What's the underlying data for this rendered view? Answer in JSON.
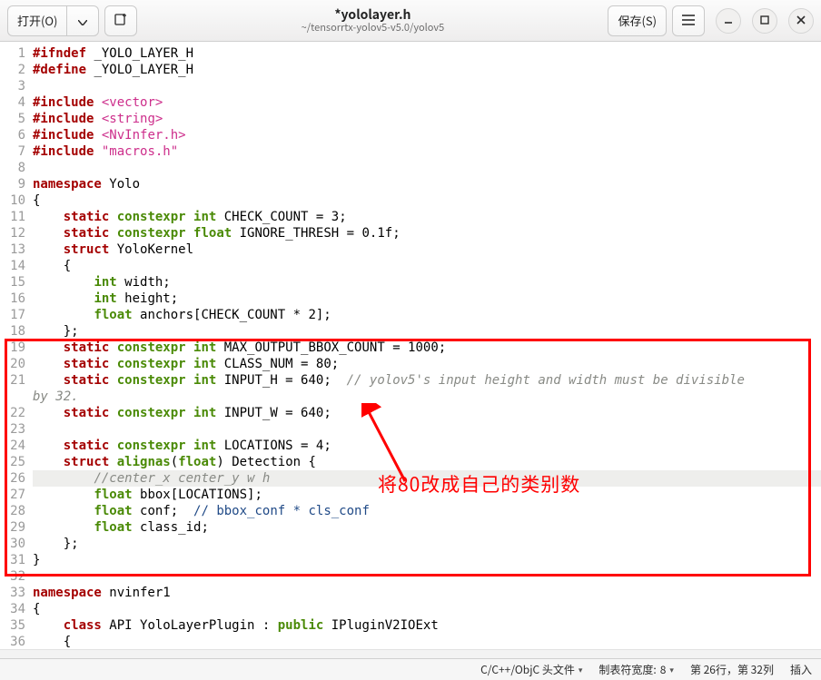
{
  "header": {
    "open_label": "打开(O)",
    "open_dropdown_icon": "chevron-down-icon",
    "new_tab_icon": "new-tab-icon",
    "title": "*yololayer.h",
    "subtitle": "~/tensorrtx-yolov5-v5.0/yolov5",
    "save_label": "保存(S)",
    "menu_icon": "hamburger-icon",
    "min_icon": "minimize-icon",
    "max_icon": "maximize-icon",
    "close_icon": "close-icon"
  },
  "annotation": {
    "text": "将80改成自己的类别数"
  },
  "status": {
    "filetype": "C/C++/ObjC 头文件",
    "tabwidth_label": "制表符宽度: ",
    "tabwidth_value": "8",
    "cursor": "第 26行，第 32列",
    "insert_mode": "插入"
  },
  "code": [
    {
      "n": 1,
      "segs": [
        {
          "c": "kw-pp",
          "t": "#ifndef"
        },
        {
          "c": "plain",
          "t": " _YOLO_LAYER_H"
        }
      ]
    },
    {
      "n": 2,
      "segs": [
        {
          "c": "kw-pp",
          "t": "#define"
        },
        {
          "c": "plain",
          "t": " _YOLO_LAYER_H"
        }
      ]
    },
    {
      "n": 3,
      "segs": [
        {
          "c": "plain",
          "t": ""
        }
      ]
    },
    {
      "n": 4,
      "segs": [
        {
          "c": "kw-pp",
          "t": "#include"
        },
        {
          "c": "plain",
          "t": " "
        },
        {
          "c": "str",
          "t": "<vector>"
        }
      ]
    },
    {
      "n": 5,
      "segs": [
        {
          "c": "kw-pp",
          "t": "#include"
        },
        {
          "c": "plain",
          "t": " "
        },
        {
          "c": "str",
          "t": "<string>"
        }
      ]
    },
    {
      "n": 6,
      "segs": [
        {
          "c": "kw-pp",
          "t": "#include"
        },
        {
          "c": "plain",
          "t": " "
        },
        {
          "c": "str",
          "t": "<NvInfer.h>"
        }
      ]
    },
    {
      "n": 7,
      "segs": [
        {
          "c": "kw-pp",
          "t": "#include"
        },
        {
          "c": "plain",
          "t": " "
        },
        {
          "c": "str",
          "t": "\"macros.h\""
        }
      ]
    },
    {
      "n": 8,
      "segs": [
        {
          "c": "plain",
          "t": ""
        }
      ]
    },
    {
      "n": 9,
      "segs": [
        {
          "c": "kw-red",
          "t": "namespace"
        },
        {
          "c": "plain",
          "t": " Yolo"
        }
      ]
    },
    {
      "n": 10,
      "segs": [
        {
          "c": "plain",
          "t": "{"
        }
      ]
    },
    {
      "n": 11,
      "segs": [
        {
          "c": "plain",
          "t": "    "
        },
        {
          "c": "kw-red",
          "t": "static"
        },
        {
          "c": "plain",
          "t": " "
        },
        {
          "c": "kw-green",
          "t": "constexpr"
        },
        {
          "c": "plain",
          "t": " "
        },
        {
          "c": "kw-green",
          "t": "int"
        },
        {
          "c": "plain",
          "t": " CHECK_COUNT = 3;"
        }
      ]
    },
    {
      "n": 12,
      "segs": [
        {
          "c": "plain",
          "t": "    "
        },
        {
          "c": "kw-red",
          "t": "static"
        },
        {
          "c": "plain",
          "t": " "
        },
        {
          "c": "kw-green",
          "t": "constexpr"
        },
        {
          "c": "plain",
          "t": " "
        },
        {
          "c": "kw-green",
          "t": "float"
        },
        {
          "c": "plain",
          "t": " IGNORE_THRESH = 0.1f;"
        }
      ]
    },
    {
      "n": 13,
      "segs": [
        {
          "c": "plain",
          "t": "    "
        },
        {
          "c": "kw-red",
          "t": "struct"
        },
        {
          "c": "plain",
          "t": " YoloKernel"
        }
      ]
    },
    {
      "n": 14,
      "segs": [
        {
          "c": "plain",
          "t": "    {"
        }
      ]
    },
    {
      "n": 15,
      "segs": [
        {
          "c": "plain",
          "t": "        "
        },
        {
          "c": "kw-green",
          "t": "int"
        },
        {
          "c": "plain",
          "t": " width;"
        }
      ]
    },
    {
      "n": 16,
      "segs": [
        {
          "c": "plain",
          "t": "        "
        },
        {
          "c": "kw-green",
          "t": "int"
        },
        {
          "c": "plain",
          "t": " height;"
        }
      ]
    },
    {
      "n": 17,
      "segs": [
        {
          "c": "plain",
          "t": "        "
        },
        {
          "c": "kw-green",
          "t": "float"
        },
        {
          "c": "plain",
          "t": " anchors[CHECK_COUNT * 2];"
        }
      ]
    },
    {
      "n": 18,
      "segs": [
        {
          "c": "plain",
          "t": "    };"
        }
      ]
    },
    {
      "n": 19,
      "segs": [
        {
          "c": "plain",
          "t": "    "
        },
        {
          "c": "kw-red",
          "t": "static"
        },
        {
          "c": "plain",
          "t": " "
        },
        {
          "c": "kw-green",
          "t": "constexpr"
        },
        {
          "c": "plain",
          "t": " "
        },
        {
          "c": "kw-green",
          "t": "int"
        },
        {
          "c": "plain",
          "t": " MAX_OUTPUT_BBOX_COUNT = 1000;"
        }
      ]
    },
    {
      "n": 20,
      "segs": [
        {
          "c": "plain",
          "t": "    "
        },
        {
          "c": "kw-red",
          "t": "static"
        },
        {
          "c": "plain",
          "t": " "
        },
        {
          "c": "kw-green",
          "t": "constexpr"
        },
        {
          "c": "plain",
          "t": " "
        },
        {
          "c": "kw-green",
          "t": "int"
        },
        {
          "c": "plain",
          "t": " CLASS_NUM = 80;"
        }
      ]
    },
    {
      "n": 21,
      "segs": [
        {
          "c": "plain",
          "t": "    "
        },
        {
          "c": "kw-red",
          "t": "static"
        },
        {
          "c": "plain",
          "t": " "
        },
        {
          "c": "kw-green",
          "t": "constexpr"
        },
        {
          "c": "plain",
          "t": " "
        },
        {
          "c": "kw-green",
          "t": "int"
        },
        {
          "c": "plain",
          "t": " INPUT_H = 640;  "
        },
        {
          "c": "cmt-it",
          "t": "// yolov5's input height and width must be divisible "
        }
      ]
    },
    {
      "n": "",
      "segs": [
        {
          "c": "cmt-it",
          "t": "by 32."
        }
      ],
      "cont": true
    },
    {
      "n": 22,
      "segs": [
        {
          "c": "plain",
          "t": "    "
        },
        {
          "c": "kw-red",
          "t": "static"
        },
        {
          "c": "plain",
          "t": " "
        },
        {
          "c": "kw-green",
          "t": "constexpr"
        },
        {
          "c": "plain",
          "t": " "
        },
        {
          "c": "kw-green",
          "t": "int"
        },
        {
          "c": "plain",
          "t": " INPUT_W = 640;"
        }
      ]
    },
    {
      "n": 23,
      "segs": [
        {
          "c": "plain",
          "t": ""
        }
      ]
    },
    {
      "n": 24,
      "segs": [
        {
          "c": "plain",
          "t": "    "
        },
        {
          "c": "kw-red",
          "t": "static"
        },
        {
          "c": "plain",
          "t": " "
        },
        {
          "c": "kw-green",
          "t": "constexpr"
        },
        {
          "c": "plain",
          "t": " "
        },
        {
          "c": "kw-green",
          "t": "int"
        },
        {
          "c": "plain",
          "t": " LOCATIONS = 4;"
        }
      ]
    },
    {
      "n": 25,
      "segs": [
        {
          "c": "plain",
          "t": "    "
        },
        {
          "c": "kw-red",
          "t": "struct"
        },
        {
          "c": "plain",
          "t": " "
        },
        {
          "c": "kw-green",
          "t": "alignas"
        },
        {
          "c": "plain",
          "t": "("
        },
        {
          "c": "kw-green",
          "t": "float"
        },
        {
          "c": "plain",
          "t": ") Detection {"
        }
      ]
    },
    {
      "n": 26,
      "hl": true,
      "segs": [
        {
          "c": "plain",
          "t": "        "
        },
        {
          "c": "cmt-it",
          "t": "//center_x center_y w h"
        }
      ]
    },
    {
      "n": 27,
      "segs": [
        {
          "c": "plain",
          "t": "        "
        },
        {
          "c": "kw-green",
          "t": "float"
        },
        {
          "c": "plain",
          "t": " bbox[LOCATIONS];"
        }
      ]
    },
    {
      "n": 28,
      "segs": [
        {
          "c": "plain",
          "t": "        "
        },
        {
          "c": "kw-green",
          "t": "float"
        },
        {
          "c": "plain",
          "t": " conf;  "
        },
        {
          "c": "cmt",
          "t": "// bbox_conf * cls_conf"
        }
      ]
    },
    {
      "n": 29,
      "segs": [
        {
          "c": "plain",
          "t": "        "
        },
        {
          "c": "kw-green",
          "t": "float"
        },
        {
          "c": "plain",
          "t": " class_id;"
        }
      ]
    },
    {
      "n": 30,
      "segs": [
        {
          "c": "plain",
          "t": "    };"
        }
      ]
    },
    {
      "n": 31,
      "segs": [
        {
          "c": "plain",
          "t": "}"
        }
      ]
    },
    {
      "n": 32,
      "segs": [
        {
          "c": "plain",
          "t": ""
        }
      ]
    },
    {
      "n": 33,
      "segs": [
        {
          "c": "kw-red",
          "t": "namespace"
        },
        {
          "c": "plain",
          "t": " nvinfer1"
        }
      ]
    },
    {
      "n": 34,
      "segs": [
        {
          "c": "plain",
          "t": "{"
        }
      ]
    },
    {
      "n": 35,
      "segs": [
        {
          "c": "plain",
          "t": "    "
        },
        {
          "c": "kw-red",
          "t": "class"
        },
        {
          "c": "plain",
          "t": " API YoloLayerPlugin : "
        },
        {
          "c": "kw-green",
          "t": "public"
        },
        {
          "c": "plain",
          "t": " IPluginV2IOExt"
        }
      ]
    },
    {
      "n": 36,
      "segs": [
        {
          "c": "plain",
          "t": "    {"
        }
      ]
    }
  ]
}
